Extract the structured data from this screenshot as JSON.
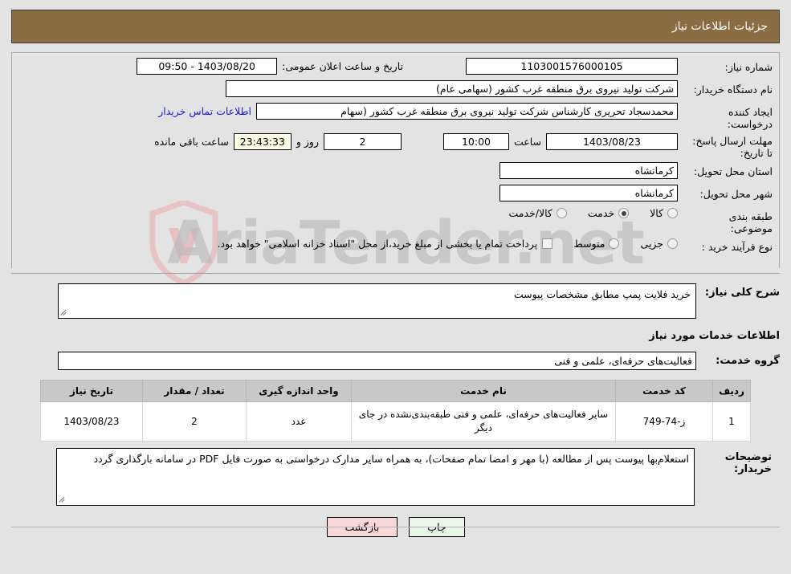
{
  "header": {
    "title": "جزئیات اطلاعات نیاز",
    "bar_color": "#8c6d43"
  },
  "watermark": {
    "text": "AriaTender.net"
  },
  "info": {
    "need_number_label": "شماره نیاز:",
    "need_number_value": "1103001576000105",
    "announce_datetime_label": "تاریخ و ساعت اعلان عمومی:",
    "announce_datetime_value": "1403/08/20 - 09:50",
    "buyer_org_label": "نام دستگاه خریدار:",
    "buyer_org_value": "شرکت تولید نیروی برق منطقه غرب کشور (سهامی عام)",
    "requester_label": "ایجاد کننده درخواست:",
    "requester_value": "محمدسجاد تحریری کارشناس شرکت تولید نیروی برق منطقه غرب کشور (سهام",
    "contact_link": "اطلاعات تماس خریدار",
    "deadline_label": "مهلت ارسال پاسخ: تا تاریخ:",
    "deadline_date": "1403/08/23",
    "hour_label": "ساعت",
    "deadline_time": "10:00",
    "days_remaining": "2",
    "days_label": "روز و",
    "countdown": "23:43:33",
    "countdown_suffix": "ساعت باقی مانده",
    "province_label": "استان محل تحویل:",
    "province_value": "کرمانشاه",
    "city_label": "شهر محل تحویل:",
    "city_value": "کرمانشاه",
    "category_label": "طبقه بندی موضوعی:",
    "category_options": [
      {
        "label": "کالا",
        "selected": false
      },
      {
        "label": "خدمت",
        "selected": true
      },
      {
        "label": "کالا/خدمت",
        "selected": false
      }
    ],
    "process_label": "نوع فرآیند خرید :",
    "process_options": [
      {
        "label": "جزیی",
        "selected": false
      },
      {
        "label": "متوسط",
        "selected": false
      }
    ],
    "treasury_note": "پرداخت تمام یا بخشی از مبلغ خرید،از محل \"اسناد خزانه اسلامی\" خواهد بود."
  },
  "middle": {
    "summary_label": "شرح کلی نیاز:",
    "summary_value": "خرید فلایت پمپ مطابق مشخصات پیوست",
    "services_heading": "اطلاعات خدمات مورد نیاز",
    "service_group_label": "گروه خدمت:",
    "service_group_value": "فعالیت‌های حرفه‌ای، علمی و فنی"
  },
  "table": {
    "columns": [
      "ردیف",
      "کد خدمت",
      "نام خدمت",
      "واحد اندازه گیری",
      "تعداد / مقدار",
      "تاریخ نیاز"
    ],
    "rows": [
      {
        "index": "1",
        "service_code": "ز-74-749",
        "service_name": "سایر فعالیت‌های حرفه‌ای، علمی و فنی طبقه‌بندی‌نشده در جای دیگر",
        "unit": "عدد",
        "quantity": "2",
        "need_date": "1403/08/23"
      }
    ]
  },
  "notes": {
    "label": "توضیحات خریدار:",
    "value": "استعلام‌بها  پیوست پس از مطالعه (با مهر و امضا تمام صفحات)، به همراه سایر مدارک درخواستی به صورت فایل PDF در سامانه بارگذاری گردد"
  },
  "footer": {
    "print_label": "چاپ",
    "back_label": "بازگشت"
  }
}
